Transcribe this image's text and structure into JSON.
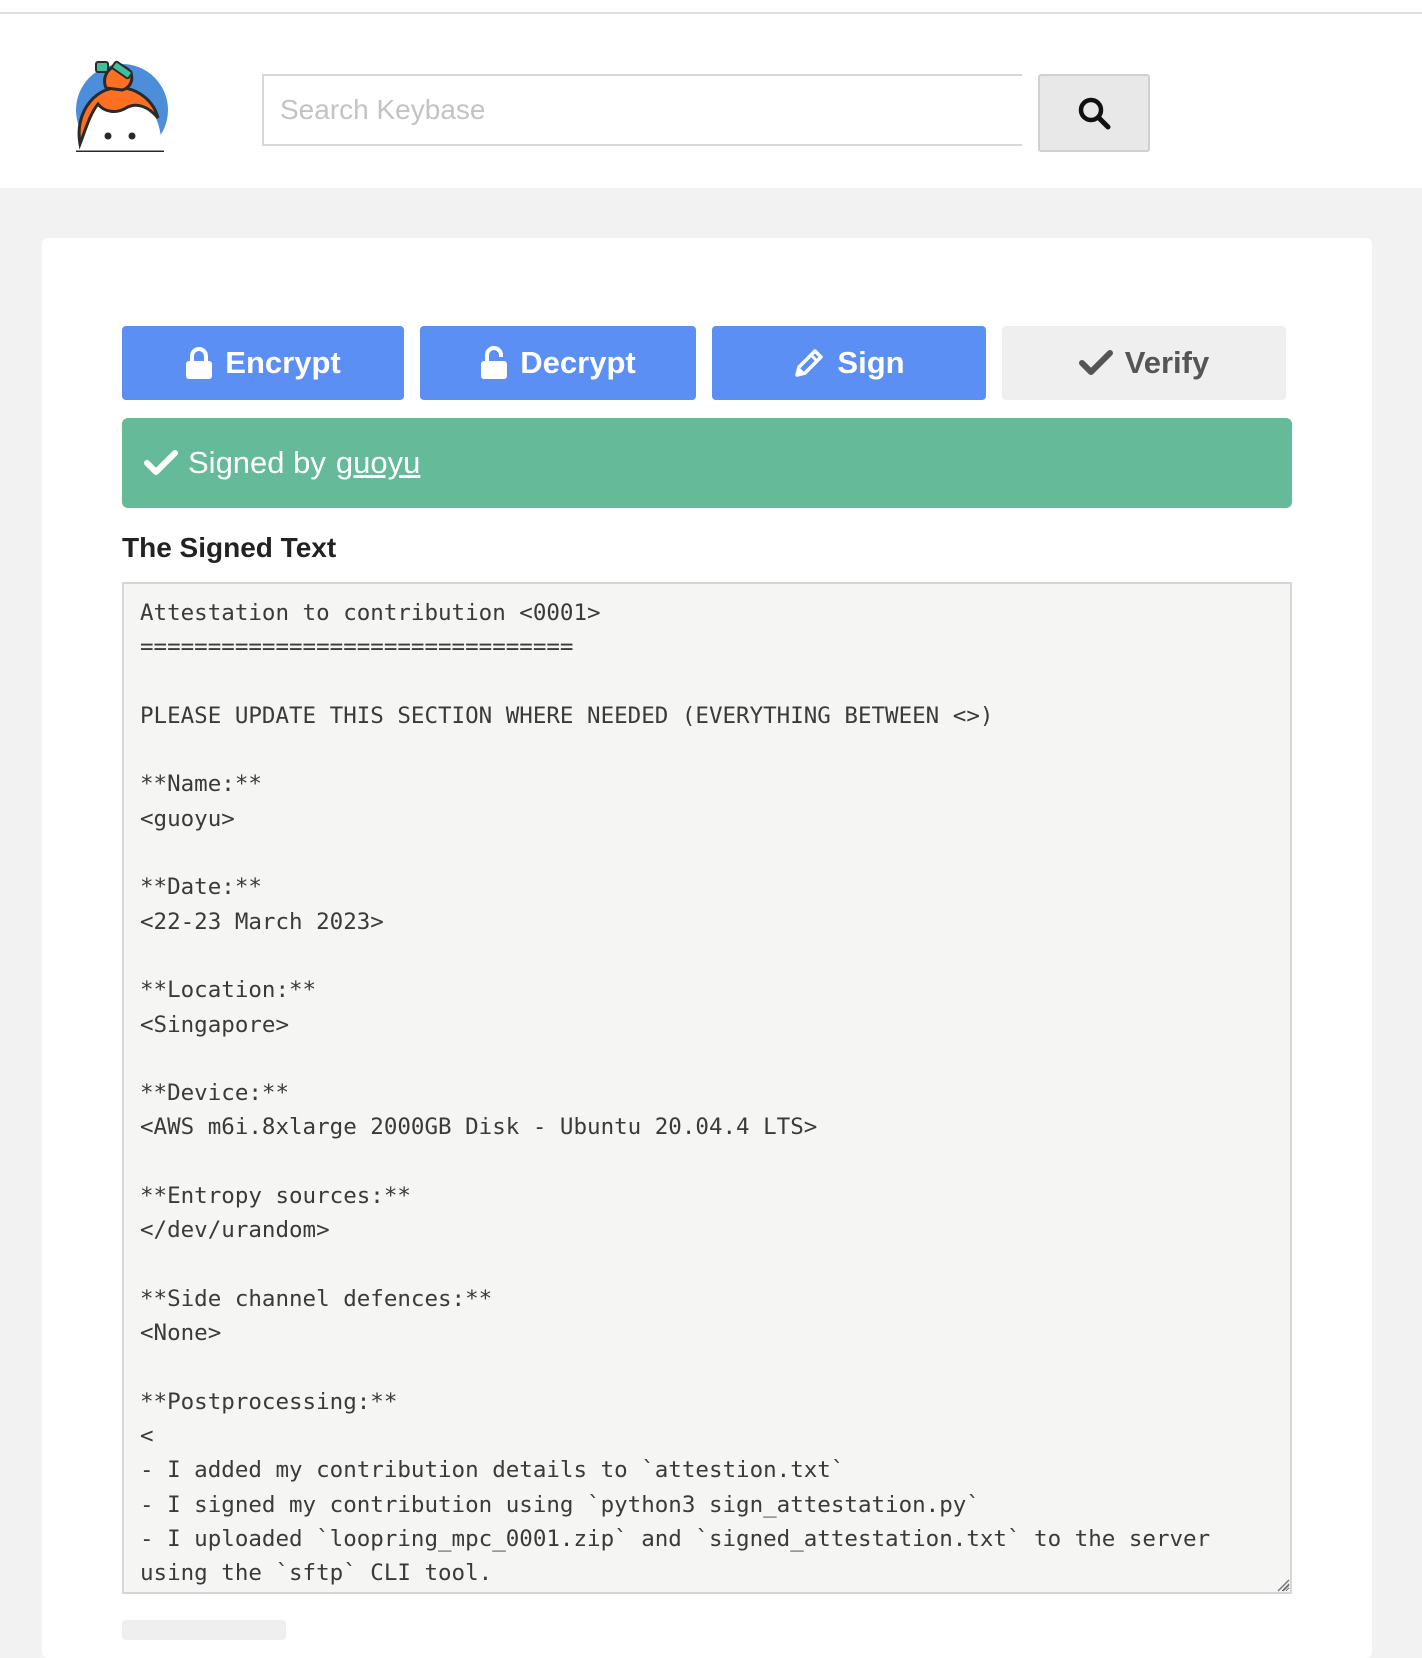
{
  "header": {
    "search": {
      "placeholder": "Search Keybase",
      "value": ""
    }
  },
  "tabs": [
    {
      "label": "Encrypt",
      "icon": "lock-icon",
      "active": false
    },
    {
      "label": "Decrypt",
      "icon": "unlock-icon",
      "active": false
    },
    {
      "label": "Sign",
      "icon": "pencil-icon",
      "active": false
    },
    {
      "label": "Verify",
      "icon": "check-icon",
      "active": true
    }
  ],
  "status": {
    "prefix": "Signed by",
    "user": "guoyu",
    "color": "#64ba99"
  },
  "section_title": "The Signed Text",
  "signed_text": "Attestation to contribution <0001>\n================================\n\nPLEASE UPDATE THIS SECTION WHERE NEEDED (EVERYTHING BETWEEN <>)\n\n**Name:**\n<guoyu>\n\n**Date:**\n<22-23 March 2023>\n\n**Location:**\n<Singapore>\n\n**Device:**\n<AWS m6i.8xlarge 2000GB Disk - Ubuntu 20.04.4 LTS>\n\n**Entropy sources:**\n</dev/urandom>\n\n**Side channel defences:**\n<None>\n\n**Postprocessing:**\n<\n- I added my contribution details to `attestion.txt`\n- I signed my contribution using `python3 sign_attestation.py`\n- I uploaded `loopring_mpc_0001.zip` and `signed_attestation.txt` to the server using the `sftp` CLI tool.",
  "colors": {
    "primary_button": "#5b8ff4",
    "active_tab": "#efefef",
    "success": "#64ba99"
  }
}
